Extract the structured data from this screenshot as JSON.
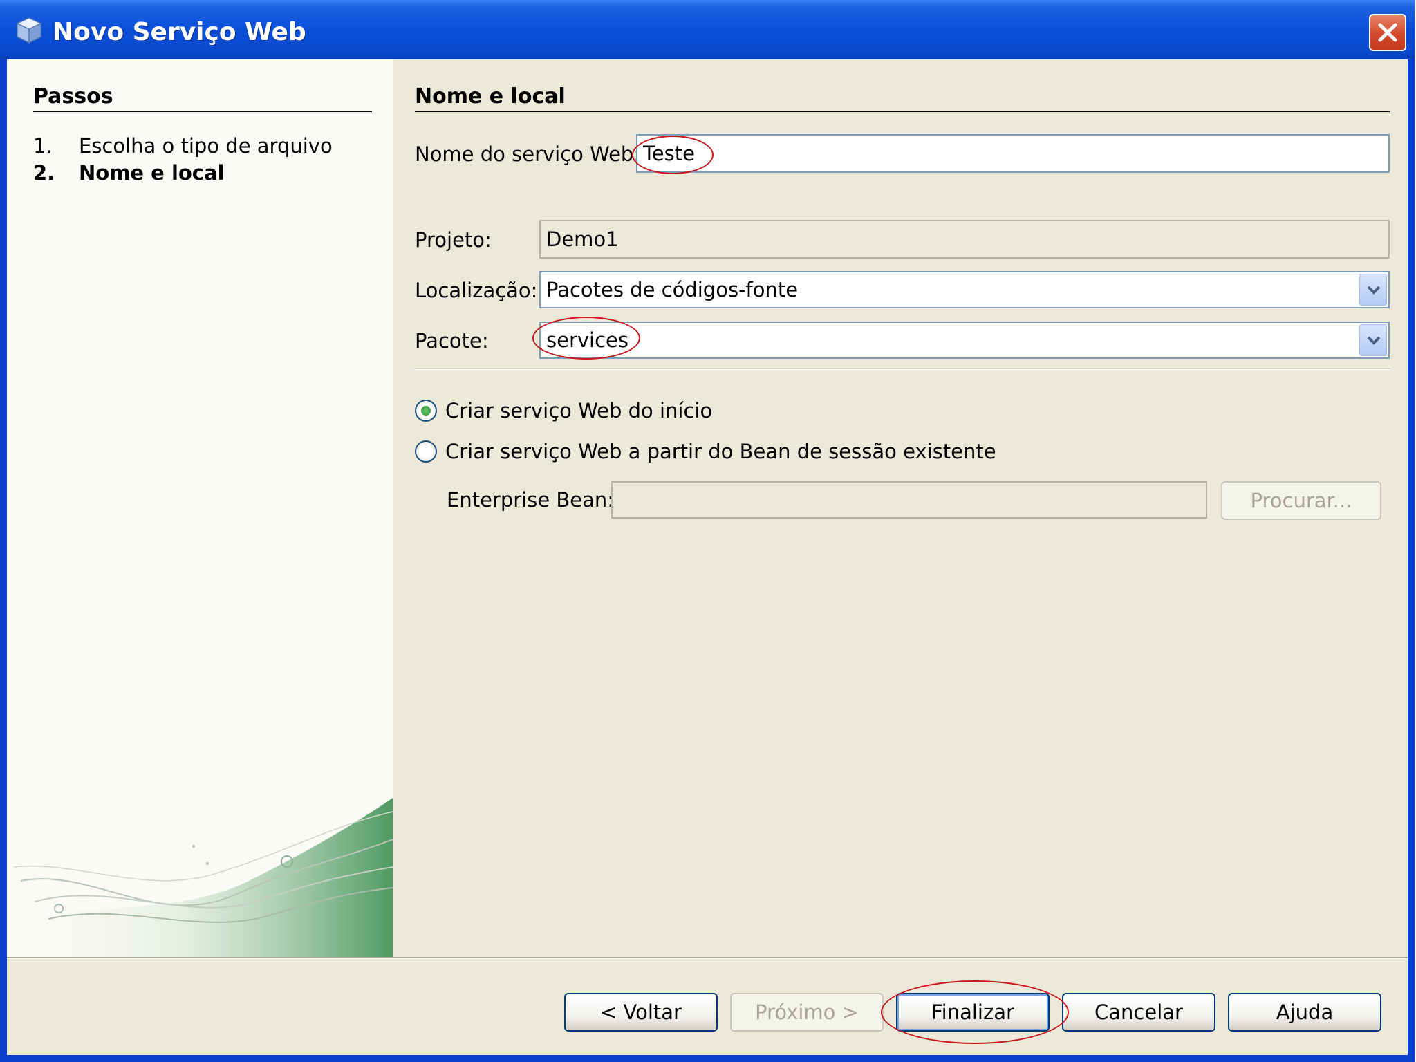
{
  "window": {
    "title": "Novo Serviço Web"
  },
  "steps": {
    "title": "Passos",
    "items": [
      {
        "num": "1.",
        "label": "Escolha o tipo de arquivo"
      },
      {
        "num": "2.",
        "label": "Nome e local"
      }
    ]
  },
  "panel": {
    "title": "Nome e local",
    "service_name": {
      "label": "Nome do serviço Web:",
      "value": "Teste"
    },
    "project": {
      "label": "Projeto:",
      "value": "Demo1"
    },
    "location": {
      "label": "Localização:",
      "value": "Pacotes de códigos-fonte"
    },
    "package": {
      "label": "Pacote:",
      "value": "services"
    },
    "radio_options": [
      {
        "label": "Criar serviço Web do início",
        "checked": true
      },
      {
        "label": "Criar serviço Web a partir do Bean de sessão existente",
        "checked": false
      }
    ],
    "enterprise_bean": {
      "label": "Enterprise Bean:",
      "value": "",
      "browse_label": "Procurar..."
    }
  },
  "buttons": {
    "back": "< Voltar",
    "next": "Próximo >",
    "finish": "Finalizar",
    "cancel": "Cancelar",
    "help": "Ajuda"
  },
  "icons": {
    "window": "cube-icon",
    "close": "close-icon",
    "dropdown": "chevron-down-icon"
  },
  "colors": {
    "titlebar": "#0a4fd8",
    "dialog_background": "#ece9d8",
    "annotation": "#c8161d"
  }
}
